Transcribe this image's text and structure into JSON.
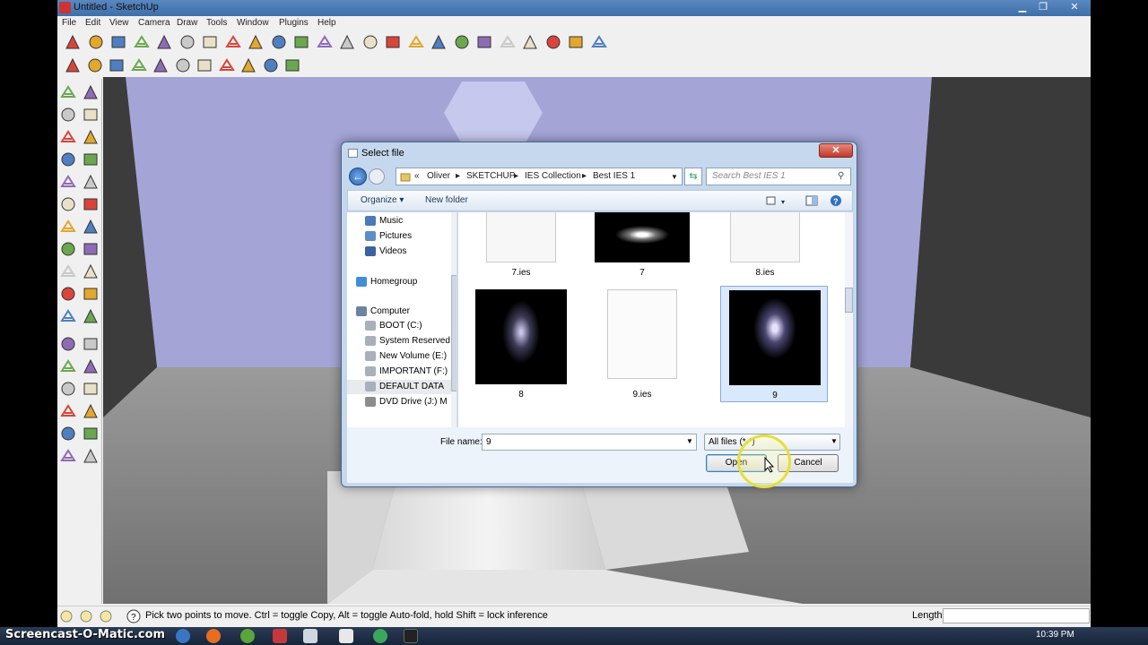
{
  "window": {
    "title": "Untitled - SketchUp",
    "buttons": [
      "minimize",
      "maximize",
      "close"
    ]
  },
  "menu": [
    "File",
    "Edit",
    "View",
    "Camera",
    "Draw",
    "Tools",
    "Window",
    "Plugins",
    "Help"
  ],
  "toolbar_row1_icons": [
    "select-icon",
    "pencil-icon",
    "rectangle-icon",
    "circle-icon",
    "arc-icon",
    "make-component-icon",
    "eraser-icon",
    "tape-measure-icon",
    "paint-bucket-icon",
    "push-pull-icon",
    "move-icon",
    "rotate-icon",
    "follow-me-icon",
    "orbit-icon",
    "pan-icon",
    "zoom-icon",
    "zoom-extents-icon",
    "get-models-icon",
    "share-model-icon",
    "share-component-icon",
    "component-icon",
    "warehouse-icon",
    "extension-icon",
    "settings-icon"
  ],
  "toolbar_row2_icons": [
    "m-plugin-icon",
    "render-icon",
    "r-plugin-icon",
    "help-plugin-icon",
    "light-icon",
    "sphere-icon",
    "spotlight-icon",
    "pointlight-icon",
    "sun-icon",
    "render-region-icon",
    "options-icon"
  ],
  "dialog": {
    "title": "Select file",
    "close_label": "✕",
    "breadcrumb": [
      "«",
      "Oliver",
      "SKETCHUP",
      "IES Collection",
      "Best IES 1"
    ],
    "search_placeholder": "Search Best IES 1",
    "organize_label": "Organize ▾",
    "new_folder_label": "New folder",
    "nav_items": [
      {
        "label": "Music",
        "icon": "music-folder-icon"
      },
      {
        "label": "Pictures",
        "icon": "pictures-folder-icon"
      },
      {
        "label": "Videos",
        "icon": "videos-folder-icon"
      },
      {
        "label": "Homegroup",
        "icon": "homegroup-icon"
      },
      {
        "label": "Computer",
        "icon": "computer-icon"
      },
      {
        "label": "BOOT (C:)",
        "icon": "drive-icon"
      },
      {
        "label": "System Reserved",
        "icon": "drive-icon"
      },
      {
        "label": "New Volume (E:)",
        "icon": "drive-icon"
      },
      {
        "label": "IMPORTANT (F:)",
        "icon": "drive-icon"
      },
      {
        "label": "DEFAULT DATA",
        "icon": "drive-icon"
      },
      {
        "label": "DVD Drive (J:) M",
        "icon": "dvd-drive-icon"
      }
    ],
    "files": [
      {
        "name": "7.ies",
        "kind": "blank"
      },
      {
        "name": "7",
        "kind": "image-spot"
      },
      {
        "name": "8.ies",
        "kind": "blank"
      },
      {
        "name": "8",
        "kind": "image-cone"
      },
      {
        "name": "9.ies",
        "kind": "doc"
      },
      {
        "name": "9",
        "kind": "image-ring",
        "selected": true
      }
    ],
    "file_name_label": "File name:",
    "file_name_value": "9",
    "file_type_value": "All files (*.*)",
    "open_label": "Open",
    "cancel_label": "Cancel"
  },
  "status": {
    "message": "Pick two points to move.  Ctrl = toggle Copy, Alt = toggle Auto-fold, hold Shift = lock inference",
    "length_label": "Length"
  },
  "taskbar": {
    "watermark": "Screencast-O-Matic.com",
    "clock": "10:39 PM"
  }
}
